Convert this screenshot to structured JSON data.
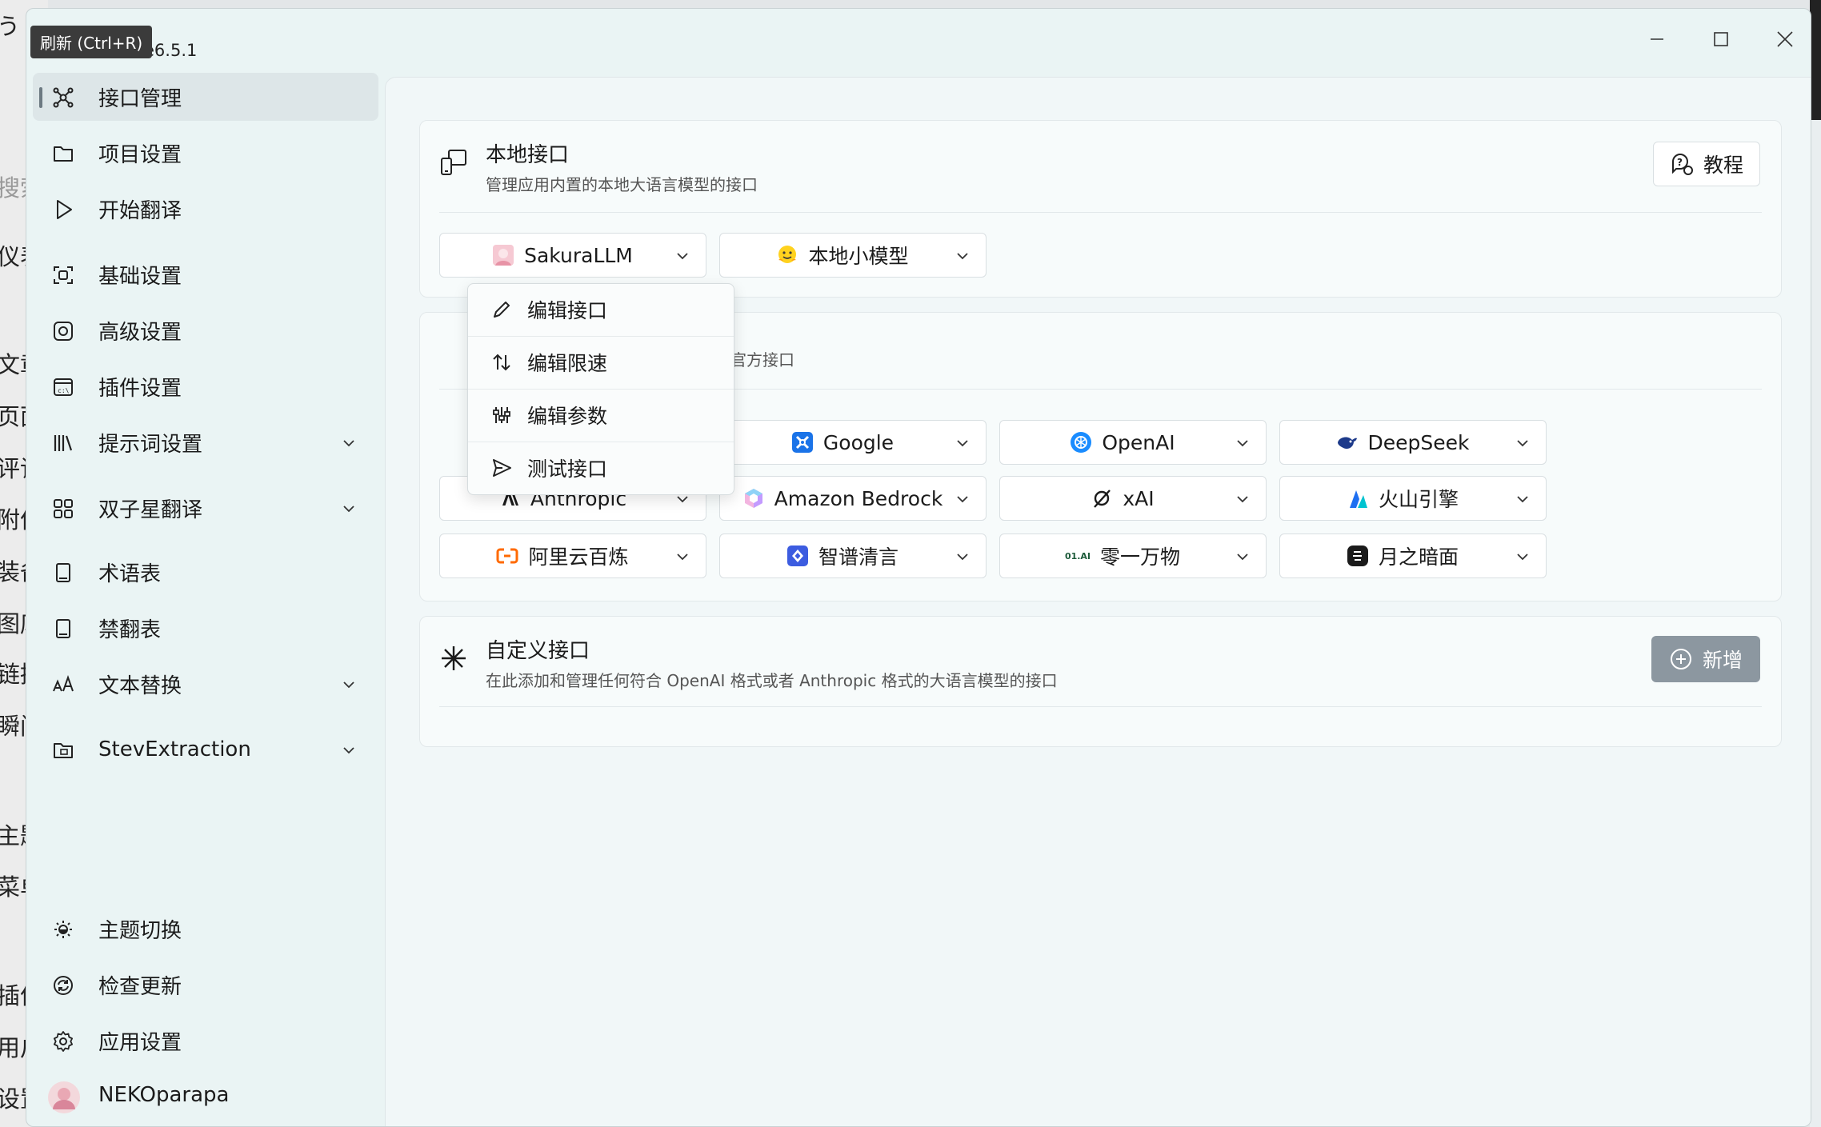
{
  "app": {
    "version_fragment": "e6.5.1",
    "tooltip": "刷新 (Ctrl+R)"
  },
  "background_window": {
    "fragments": [
      "う",
      "搜索",
      "仪表",
      "文章",
      "页面",
      "评论",
      "附件",
      "装备",
      "图库",
      "链接",
      "瞬间",
      "主题",
      "菜单",
      "插件",
      "用户",
      "设置"
    ]
  },
  "sidebar": {
    "items": [
      {
        "label": "接口管理",
        "icon": "network-icon",
        "active": true
      },
      {
        "label": "项目设置",
        "icon": "folder-icon"
      },
      {
        "label": "开始翻译",
        "icon": "play-icon"
      },
      {
        "label": "基础设置",
        "icon": "frame-icon"
      },
      {
        "label": "高级设置",
        "icon": "target-icon"
      },
      {
        "label": "插件设置",
        "icon": "terminal-icon"
      },
      {
        "label": "提示词设置",
        "icon": "library-icon",
        "expandable": true
      },
      {
        "label": "双子星翻译",
        "icon": "grid-icon",
        "expandable": true
      },
      {
        "label": "术语表",
        "icon": "book-icon"
      },
      {
        "label": "禁翻表",
        "icon": "book-icon"
      },
      {
        "label": "文本替换",
        "icon": "font-size-icon",
        "expandable": true
      },
      {
        "label": "StevExtraction",
        "icon": "folder-box-icon",
        "expandable": true
      }
    ],
    "bottom": [
      {
        "label": "主题切换",
        "icon": "brightness-icon"
      },
      {
        "label": "检查更新",
        "icon": "sync-icon"
      },
      {
        "label": "应用设置",
        "icon": "gear-icon"
      },
      {
        "label": "NEKOparapa",
        "icon": "avatar"
      }
    ]
  },
  "local_api": {
    "title": "本地接口",
    "desc": "管理应用内置的本地大语言模型的接口",
    "tutorial_label": "教程",
    "items": [
      {
        "label": "SakuraLLM",
        "logo": "sakura-logo"
      },
      {
        "label": "本地小模型",
        "logo": "hugging-face-logo"
      }
    ]
  },
  "official_api": {
    "desc_fragment": "型的官方接口",
    "items": [
      {
        "label": "Google",
        "logo": "google-logo"
      },
      {
        "label": "OpenAI",
        "logo": "openai-logo"
      },
      {
        "label": "DeepSeek",
        "logo": "deepseek-logo"
      },
      {
        "label": "Anthropic",
        "logo": "anthropic-logo"
      },
      {
        "label": "Amazon Bedrock",
        "logo": "bedrock-logo"
      },
      {
        "label": "xAI",
        "logo": "xai-logo"
      },
      {
        "label": "火山引擎",
        "logo": "volcengine-logo"
      },
      {
        "label": "阿里云百炼",
        "logo": "aliyun-logo"
      },
      {
        "label": "智谱清言",
        "logo": "zhipu-logo"
      },
      {
        "label": "零一万物",
        "logo": "01ai-logo",
        "logo_text": "01.AI"
      },
      {
        "label": "月之暗面",
        "logo": "moonshot-logo"
      }
    ]
  },
  "custom_api": {
    "title": "自定义接口",
    "desc": "在此添加和管理任何符合 OpenAI 格式或者 Anthropic 格式的大语言模型的接口",
    "add_label": "新增"
  },
  "context_menu": {
    "items": [
      {
        "label": "编辑接口",
        "icon": "pencil-icon"
      },
      {
        "label": "编辑限速",
        "icon": "arrows-up-down-icon"
      },
      {
        "label": "编辑参数",
        "icon": "sliders-icon"
      },
      {
        "label": "测试接口",
        "icon": "send-icon"
      }
    ]
  },
  "colors": {
    "accent": "#6d7a82",
    "add_button": "#8c97a0",
    "google": "#1a73e8",
    "openai": "#1a8cff",
    "deepseek": "#1d3a8a",
    "volcengine": "#1e6ff1",
    "aliyun": "#ff6a00",
    "zhipu": "#3c5ce0"
  }
}
